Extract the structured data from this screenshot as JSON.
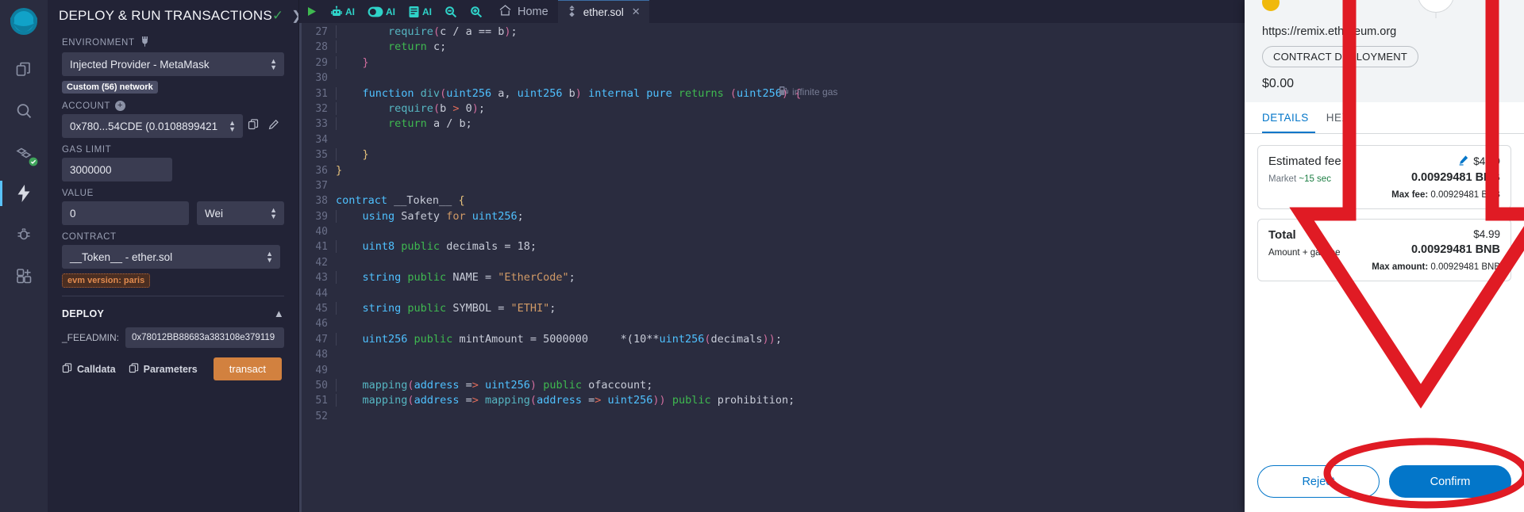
{
  "rail": {
    "logo": "remix-logo",
    "items": [
      {
        "name": "file-explorer-icon",
        "label": "File explorer"
      },
      {
        "name": "search-icon",
        "label": "Search in files"
      },
      {
        "name": "solidity-compiler-icon",
        "label": "Solidity compiler"
      },
      {
        "name": "deploy-run-icon",
        "label": "Deploy & run transactions"
      },
      {
        "name": "debugger-icon",
        "label": "Debugger"
      },
      {
        "name": "plugin-manager-icon",
        "label": "Plugin manager"
      }
    ]
  },
  "panel": {
    "title": "DEPLOY & RUN TRANSACTIONS",
    "check_icon": "check-icon",
    "chevron_icon": "chevron-right-icon",
    "environment_label": "ENVIRONMENT",
    "environment_icon": "plug-icon",
    "environment_value": "Injected Provider - MetaMask",
    "environment_info_icon": "info-icon",
    "network_badge": "Custom (56) network",
    "account_label": "ACCOUNT",
    "account_plus": "+",
    "account_value": "0x780...54CDE (0.0108899421",
    "account_copy_icon": "copy-icon",
    "account_edit_icon": "edit-icon",
    "gas_limit_label": "GAS LIMIT",
    "gas_limit_value": "3000000",
    "value_label": "VALUE",
    "value_value": "0",
    "value_unit": "Wei",
    "contract_label": "CONTRACT",
    "contract_value": "__Token__ - ether.sol",
    "evm_badge": "evm version: paris",
    "deploy_label": "DEPLOY",
    "deploy_collapse_icon": "chevron-up-icon",
    "feeadmin_label": "_FEEADMIN:",
    "feeadmin_value": "0x78012BB88683a383108e379119",
    "calldata_label": "Calldata",
    "calldata_icon": "copy-icon",
    "parameters_label": "Parameters",
    "parameters_icon": "copy-icon",
    "transact_label": "transact"
  },
  "editor": {
    "toolbar": [
      {
        "name": "run-icon",
        "label": ""
      },
      {
        "name": "robot-ai-icon",
        "label": "AI"
      },
      {
        "name": "toggle-ai-icon",
        "label": "AI"
      },
      {
        "name": "docs-ai-icon",
        "label": "AI"
      },
      {
        "name": "zoom-out-icon",
        "label": ""
      },
      {
        "name": "zoom-in-icon",
        "label": ""
      }
    ],
    "home_label": "Home",
    "home_icon": "home-icon",
    "tab": {
      "icon": "solidity-file-icon",
      "label": "ether.sol",
      "close_icon": "close-icon"
    },
    "gas_hint": "infinite gas",
    "gas_hint_icon": "gas-pump-icon",
    "first_line_number": 27,
    "lines": [
      {
        "n": 27,
        "indent": 2,
        "tokens": [
          {
            "t": "require",
            "c": "fn"
          },
          {
            "t": "(",
            "c": "pn"
          },
          {
            "t": "c ",
            "c": "wt"
          },
          {
            "t": "/",
            "c": "wt"
          },
          {
            "t": " a ",
            "c": "wt"
          },
          {
            "t": "==",
            "c": "wt"
          },
          {
            "t": " b",
            "c": "wt"
          },
          {
            "t": ")",
            "c": "pn"
          },
          {
            "t": ";",
            "c": "wt"
          }
        ]
      },
      {
        "n": 28,
        "indent": 2,
        "tokens": [
          {
            "t": "return",
            "c": "gr"
          },
          {
            "t": " c;",
            "c": "wt"
          }
        ]
      },
      {
        "n": 29,
        "indent": 1,
        "tokens": [
          {
            "t": "}",
            "c": "pn"
          }
        ]
      },
      {
        "n": 30,
        "indent": 0,
        "tokens": []
      },
      {
        "n": 31,
        "indent": 1,
        "tokens": [
          {
            "t": "function ",
            "c": "kb"
          },
          {
            "t": "div",
            "c": "fn"
          },
          {
            "t": "(",
            "c": "pn"
          },
          {
            "t": "uint256",
            "c": "kb"
          },
          {
            "t": " a, ",
            "c": "wt"
          },
          {
            "t": "uint256",
            "c": "kb"
          },
          {
            "t": " b",
            "c": "wt"
          },
          {
            "t": ")",
            "c": "pn"
          },
          {
            "t": " internal ",
            "c": "kb"
          },
          {
            "t": "pure ",
            "c": "kb"
          },
          {
            "t": "returns",
            "c": "gr"
          },
          {
            "t": " (",
            "c": "pn"
          },
          {
            "t": "uint256",
            "c": "kb"
          },
          {
            "t": ")",
            "c": "pn"
          },
          {
            "t": " {",
            "c": "pn"
          }
        ]
      },
      {
        "n": 32,
        "indent": 2,
        "tokens": [
          {
            "t": "require",
            "c": "fn"
          },
          {
            "t": "(",
            "c": "pn"
          },
          {
            "t": "b ",
            "c": "wt"
          },
          {
            "t": ">",
            "c": "rd"
          },
          {
            "t": " 0",
            "c": "wt"
          },
          {
            "t": ")",
            "c": "pn"
          },
          {
            "t": ";",
            "c": "wt"
          }
        ]
      },
      {
        "n": 33,
        "indent": 2,
        "tokens": [
          {
            "t": "return",
            "c": "gr"
          },
          {
            "t": " a / b;",
            "c": "wt"
          }
        ]
      },
      {
        "n": 34,
        "indent": 0,
        "tokens": []
      },
      {
        "n": 35,
        "indent": 1,
        "tokens": [
          {
            "t": "}",
            "c": "ye"
          }
        ]
      },
      {
        "n": 36,
        "indent": 0,
        "tokens": [
          {
            "t": "}",
            "c": "ye"
          }
        ]
      },
      {
        "n": 37,
        "indent": 0,
        "tokens": []
      },
      {
        "n": 38,
        "indent": 0,
        "tokens": [
          {
            "t": "contract ",
            "c": "kb"
          },
          {
            "t": "__Token__",
            "c": "wt"
          },
          {
            "t": " {",
            "c": "ye"
          }
        ]
      },
      {
        "n": 39,
        "indent": 1,
        "tokens": [
          {
            "t": "using ",
            "c": "kb"
          },
          {
            "t": "Safety",
            "c": "wt"
          },
          {
            "t": " for ",
            "c": "st"
          },
          {
            "t": "uint256",
            "c": "kb"
          },
          {
            "t": ";",
            "c": "wt"
          }
        ]
      },
      {
        "n": 40,
        "indent": 0,
        "tokens": []
      },
      {
        "n": 41,
        "indent": 1,
        "tokens": [
          {
            "t": "uint8 ",
            "c": "kb"
          },
          {
            "t": "public ",
            "c": "gr"
          },
          {
            "t": "decimals",
            "c": "wt"
          },
          {
            "t": " = ",
            "c": "wt"
          },
          {
            "t": "18",
            "c": "wt"
          },
          {
            "t": ";",
            "c": "wt"
          }
        ]
      },
      {
        "n": 42,
        "indent": 0,
        "tokens": []
      },
      {
        "n": 43,
        "indent": 1,
        "tokens": [
          {
            "t": "string ",
            "c": "kb"
          },
          {
            "t": "public ",
            "c": "gr"
          },
          {
            "t": "NAME",
            "c": "wt"
          },
          {
            "t": " = ",
            "c": "wt"
          },
          {
            "t": "\"EtherCode\"",
            "c": "st"
          },
          {
            "t": ";",
            "c": "wt"
          }
        ]
      },
      {
        "n": 44,
        "indent": 0,
        "tokens": []
      },
      {
        "n": 45,
        "indent": 1,
        "tokens": [
          {
            "t": "string ",
            "c": "kb"
          },
          {
            "t": "public ",
            "c": "gr"
          },
          {
            "t": "SYMBOL",
            "c": "wt"
          },
          {
            "t": " = ",
            "c": "wt"
          },
          {
            "t": "\"ETHI\"",
            "c": "st"
          },
          {
            "t": ";",
            "c": "wt"
          }
        ]
      },
      {
        "n": 46,
        "indent": 0,
        "tokens": []
      },
      {
        "n": 47,
        "indent": 1,
        "tokens": [
          {
            "t": "uint256 ",
            "c": "kb"
          },
          {
            "t": "public ",
            "c": "gr"
          },
          {
            "t": "mintAmount",
            "c": "wt"
          },
          {
            "t": " = ",
            "c": "wt"
          },
          {
            "t": "5000000",
            "c": "wt"
          },
          {
            "t": "     *(",
            "c": "wt"
          },
          {
            "t": "10",
            "c": "wt"
          },
          {
            "t": "**",
            "c": "wt"
          },
          {
            "t": "uint256",
            "c": "kb"
          },
          {
            "t": "(",
            "c": "pn"
          },
          {
            "t": "decimals",
            "c": "wt"
          },
          {
            "t": "))",
            "c": "pn"
          },
          {
            "t": ";",
            "c": "wt"
          }
        ]
      },
      {
        "n": 48,
        "indent": 0,
        "tokens": []
      },
      {
        "n": 49,
        "indent": 0,
        "tokens": []
      },
      {
        "n": 50,
        "indent": 1,
        "tokens": [
          {
            "t": "mapping",
            "c": "fn"
          },
          {
            "t": "(",
            "c": "pn"
          },
          {
            "t": "address",
            "c": "kb"
          },
          {
            "t": " =",
            "c": "wt"
          },
          {
            "t": ">",
            "c": "rd"
          },
          {
            "t": " ",
            "c": "wt"
          },
          {
            "t": "uint256",
            "c": "kb"
          },
          {
            "t": ")",
            "c": "pn"
          },
          {
            "t": " public ",
            "c": "gr"
          },
          {
            "t": "ofaccount;",
            "c": "wt"
          }
        ]
      },
      {
        "n": 51,
        "indent": 1,
        "tokens": [
          {
            "t": "mapping",
            "c": "fn"
          },
          {
            "t": "(",
            "c": "pn"
          },
          {
            "t": "address",
            "c": "kb"
          },
          {
            "t": " =",
            "c": "wt"
          },
          {
            "t": ">",
            "c": "rd"
          },
          {
            "t": " ",
            "c": "wt"
          },
          {
            "t": "mapping",
            "c": "fn"
          },
          {
            "t": "(",
            "c": "pn"
          },
          {
            "t": "address",
            "c": "kb"
          },
          {
            "t": " =",
            "c": "wt"
          },
          {
            "t": ">",
            "c": "rd"
          },
          {
            "t": " ",
            "c": "wt"
          },
          {
            "t": "uint256",
            "c": "kb"
          },
          {
            "t": "))",
            "c": "pn"
          },
          {
            "t": " public ",
            "c": "gr"
          },
          {
            "t": "prohibition;",
            "c": "wt"
          }
        ]
      },
      {
        "n": 52,
        "indent": 0,
        "tokens": []
      }
    ]
  },
  "metamask": {
    "coin_icon": "bnb-coin-icon",
    "account_circle_icon": "account-avatar-icon",
    "url": "https://remix.ethereum.org",
    "deployment_pill": "CONTRACT DEPLOYMENT",
    "amount": "$0.00",
    "tabs": [
      {
        "label": "DETAILS",
        "selected": true
      },
      {
        "label": "HEX",
        "selected": false
      }
    ],
    "fee": {
      "label": "Estimated fee",
      "market_label": "Market",
      "market_time": "~15 sec",
      "edit_icon": "pencil-edit-icon",
      "usd": "$4.99",
      "crypto": "0.00929481 BNB",
      "max_fee_label": "Max fee:",
      "max_fee_value": "0.00929481 BNB"
    },
    "total": {
      "label": "Total",
      "sub_label": "Amount + gas fee",
      "usd": "$4.99",
      "crypto": "0.00929481 BNB",
      "max_amount_label": "Max amount:",
      "max_amount_value": "0.00929481 BNB"
    },
    "reject_label": "Reject",
    "confirm_label": "Confirm"
  },
  "annotation": {
    "arrow_color": "#e01b24",
    "target": "confirm-button"
  }
}
